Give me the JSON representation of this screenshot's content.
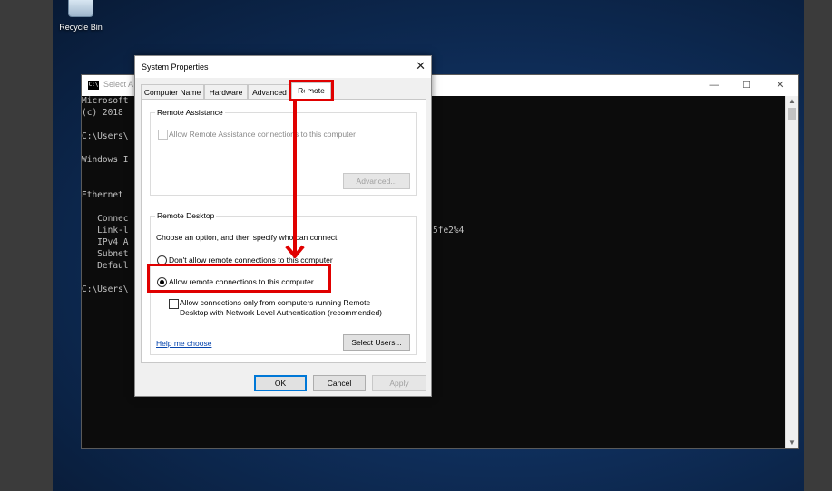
{
  "desktop": {
    "recycle_bin_label": "Recycle Bin"
  },
  "cmd": {
    "title": "Select A",
    "controls": {
      "minimize": "—",
      "maximize": "☐",
      "close": "✕"
    },
    "lines": [
      "Microsoft",
      "(c) 2018",
      "",
      "C:\\Users\\",
      "",
      "Windows I",
      "",
      "",
      "Ethernet",
      "",
      "   Connec",
      "   Link-l",
      "   IPv4 A",
      "   Subnet",
      "   Defaul",
      "",
      "C:\\Users\\"
    ],
    "ipv6_suffix": "5fe2%4"
  },
  "dialog": {
    "title": "System Properties",
    "close": "✕",
    "tabs": [
      "Computer Name",
      "Hardware",
      "Advanced",
      "Remote"
    ],
    "active_tab": "Remote",
    "remote_assistance": {
      "group_label": "Remote Assistance",
      "checkbox_label": "Allow Remote Assistance connections to this computer",
      "advanced_button": "Advanced..."
    },
    "remote_desktop": {
      "group_label": "Remote Desktop",
      "instruction": "Choose an option, and then specify who can connect.",
      "option_dont_allow": "Don't allow remote connections to this computer",
      "option_allow": "Allow remote connections to this computer",
      "selected": "allow",
      "nla_line1": "Allow connections only from computers running Remote",
      "nla_line2": "Desktop with Network Level Authentication (recommended)",
      "help_link": "Help me choose",
      "select_users_button": "Select Users..."
    },
    "buttons": {
      "ok": "OK",
      "cancel": "Cancel",
      "apply": "Apply"
    }
  },
  "annotation": {
    "color": "#e00000"
  }
}
